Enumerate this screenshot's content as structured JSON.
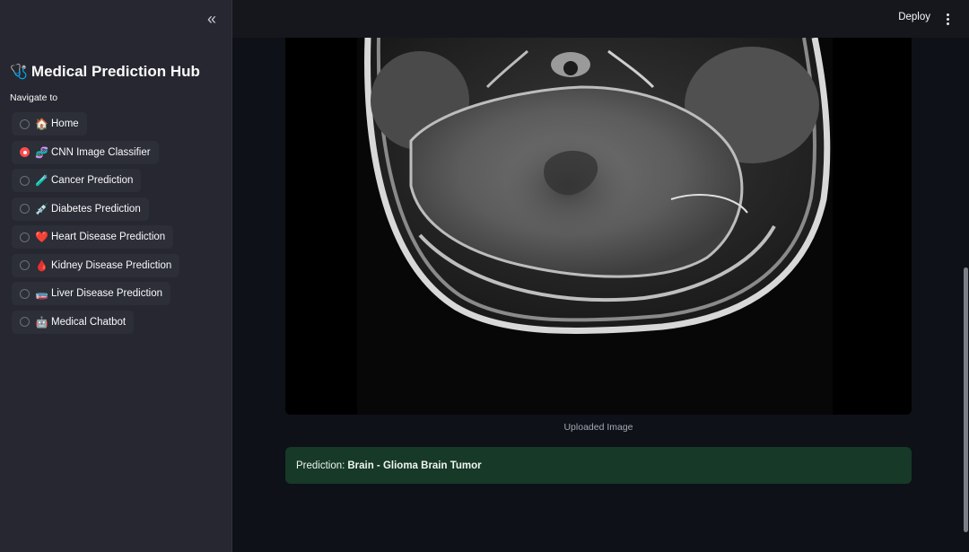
{
  "sidebar": {
    "collapse_icon": "chevron-double-left-icon",
    "title_emoji": "🩺",
    "title": "Medical Prediction Hub",
    "nav_label": "Navigate to",
    "items": [
      {
        "emoji": "🏠",
        "label": "Home",
        "checked": false
      },
      {
        "emoji": "🧬",
        "label": "CNN Image Classifier",
        "checked": true
      },
      {
        "emoji": "🧪",
        "label": "Cancer Prediction",
        "checked": false
      },
      {
        "emoji": "💉",
        "label": "Diabetes Prediction",
        "checked": false
      },
      {
        "emoji": "❤️",
        "label": "Heart Disease Prediction",
        "checked": false
      },
      {
        "emoji": "🩸",
        "label": "Kidney Disease Prediction",
        "checked": false
      },
      {
        "emoji": "🧫",
        "label": "Liver Disease Prediction",
        "checked": false
      },
      {
        "emoji": "🤖",
        "label": "Medical Chatbot",
        "checked": false
      }
    ]
  },
  "header": {
    "deploy_label": "Deploy",
    "menu_icon": "more-vertical-icon"
  },
  "main": {
    "image_caption": "Uploaded Image",
    "prediction_prefix": "Prediction:",
    "prediction_value": "Brain - Glioma Brain Tumor"
  },
  "colors": {
    "accent": "#ff4b4b",
    "sidebar_bg": "#262730",
    "main_bg": "#0e1117",
    "success_bg": "#173928"
  }
}
